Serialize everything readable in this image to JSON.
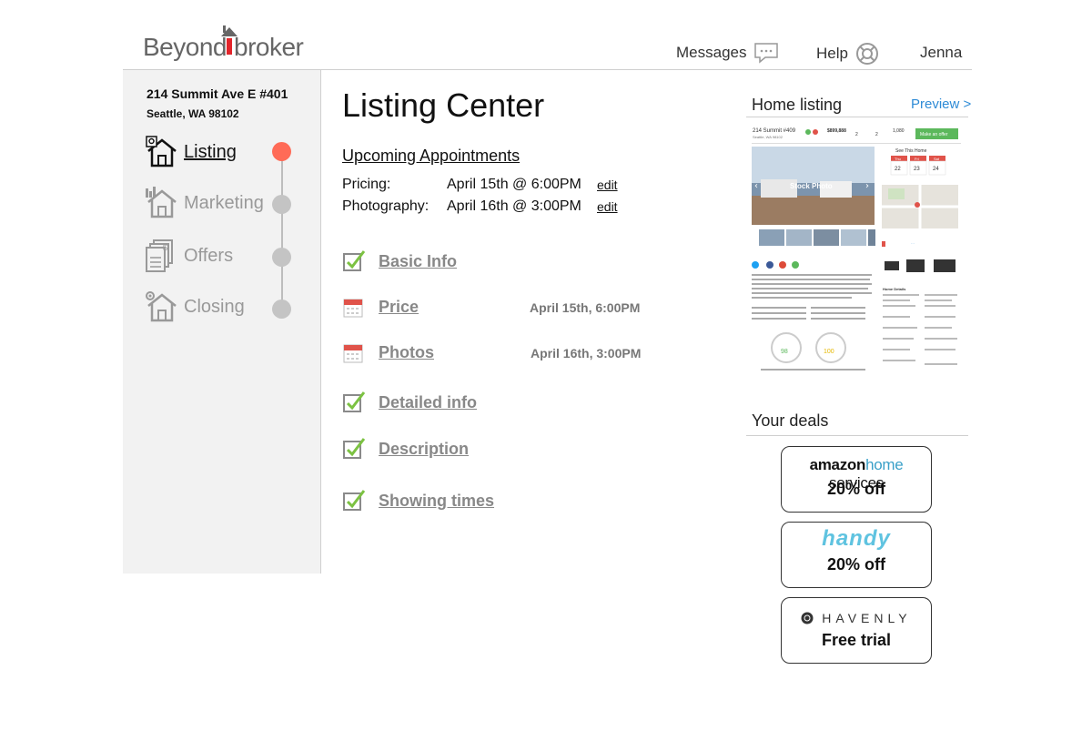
{
  "brand": {
    "left": "Beyond",
    "right": "broker",
    "accent": "#e3252b"
  },
  "nav": {
    "messages": "Messages",
    "help": "Help",
    "user": "Jenna"
  },
  "property": {
    "address_line1": "214 Summit Ave E #401",
    "address_line2": "Seattle, WA 98102"
  },
  "steps": [
    {
      "label": "Listing",
      "active": true,
      "icon": "house-pin-icon"
    },
    {
      "label": "Marketing",
      "active": false,
      "icon": "house-chart-icon"
    },
    {
      "label": "Offers",
      "active": false,
      "icon": "documents-dollar-icon"
    },
    {
      "label": "Closing",
      "active": false,
      "icon": "house-gear-icon"
    }
  ],
  "main": {
    "title": "Listing Center",
    "upcoming_title": "Upcoming Appointments",
    "appointments": [
      {
        "label": "Pricing:",
        "value": "April 15th @ 6:00PM",
        "edit": "edit"
      },
      {
        "label": "Photography:",
        "value": "April 16th @ 3:00PM",
        "edit": "edit"
      }
    ],
    "tasks": [
      {
        "label": "Basic Info",
        "status": "done",
        "date": ""
      },
      {
        "label": "Price",
        "status": "scheduled",
        "date": "April 15th, 6:00PM"
      },
      {
        "label": "Photos",
        "status": "scheduled",
        "date": "April 16th, 3:00PM"
      },
      {
        "label": "Detailed info",
        "status": "done",
        "date": ""
      },
      {
        "label": "Description",
        "status": "done",
        "date": ""
      },
      {
        "label": "Showing times",
        "status": "done",
        "date": ""
      }
    ]
  },
  "right_panel": {
    "home_listing_title": "Home listing",
    "preview_link": "Preview >",
    "preview": {
      "address": "214 Summit #409",
      "city": "Seattle, WA 98102",
      "price": "$899,888",
      "beds": "2",
      "baths": "2",
      "sqft": "1,080",
      "cta": "Make an offer",
      "photo_label": "Stock Photo",
      "see_home": "See This Home",
      "days": [
        {
          "d": "Thu",
          "n": "22"
        },
        {
          "d": "Fri",
          "n": "23"
        },
        {
          "d": "Sat",
          "n": "24"
        }
      ],
      "walk_score": "98",
      "transit_score": "100",
      "home_details": "Home Details"
    },
    "deals_title": "Your deals",
    "deals": [
      {
        "brand_a": "amazon",
        "brand_b": "home",
        "brand_c": "services",
        "offer": "20% off"
      },
      {
        "brand": "handy",
        "offer": "20% off"
      },
      {
        "brand": "HAVENLY",
        "offer": "Free trial"
      }
    ]
  },
  "colors": {
    "active_dot": "#ff6b57",
    "inactive_dot": "#c4c4c4",
    "check": "#7cc242",
    "link": "#2e8bd6",
    "calendar": "#e0534a"
  }
}
